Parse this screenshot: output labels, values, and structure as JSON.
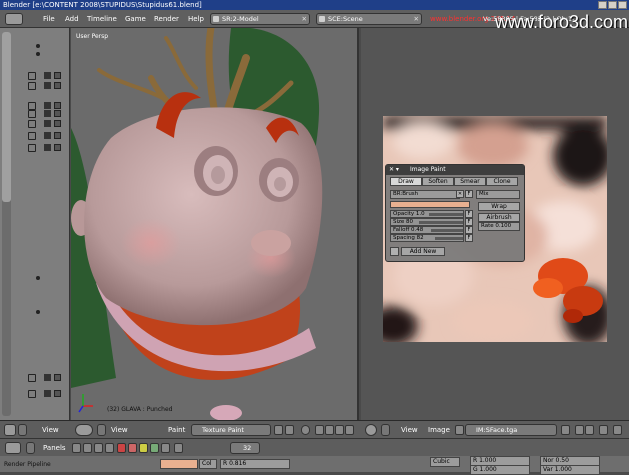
{
  "window": {
    "title": "Blender [e:\\CONTENT 2008\\STUPIDUS\\Stupidus61.blend]"
  },
  "menubar": {
    "menus": [
      "File",
      "Add",
      "Timeline",
      "Game",
      "Render",
      "Help"
    ],
    "screen_field": "SR:2-Model",
    "scene_field": "SCE:Scene",
    "url": "www.blender.org 246.14",
    "stats": "Ve:58385 | Fa:58272 | Ob:1-1",
    "watermark": "www.foro3d.com"
  },
  "viewport": {
    "label": "User Persp",
    "info": "(32) GLAVA : Punched",
    "colors": {
      "skin": "#c9a8a8",
      "mouth": "#c0421b",
      "horns": "#b8300f",
      "tree": "#2c5a2f",
      "branches": "#8a6a3a"
    }
  },
  "image_paint": {
    "title": "Image Paint",
    "tools": [
      "Draw",
      "Soften",
      "Smear",
      "Clone"
    ],
    "active_tool": "Draw",
    "brush_field": "BR:Brush",
    "brush_flag": "F",
    "blend_mode": "Mix",
    "opacity": "Opacity 1.0",
    "size": "Size 80",
    "falloff": "Falloff 0.48",
    "spacing": "Spacing 82",
    "wrap_label": "Wrap",
    "airbrush_label": "Airbrush",
    "rate": "Rate 0.100",
    "add_new_label": "Add New",
    "field_flag": "F"
  },
  "viewport_header": {
    "view": "View",
    "mode_left": "Paint",
    "mode": "Texture Paint"
  },
  "uv_header": {
    "view": "View",
    "image": "Image",
    "image_field": "IM:SFace.tga"
  },
  "outliner_header": {
    "view": "View"
  },
  "buttons_header": {
    "panels": "Panels",
    "frame": "32"
  },
  "buttons": {
    "render_pipeline": "Render Pipeline",
    "col_label": "Col",
    "col_value": "R 0.816",
    "cubic": "Cubic",
    "blend_r": "R 1.000",
    "blend_g": "G 1.000",
    "nor": "Nor 0.50",
    "var": "Var 1.000"
  }
}
